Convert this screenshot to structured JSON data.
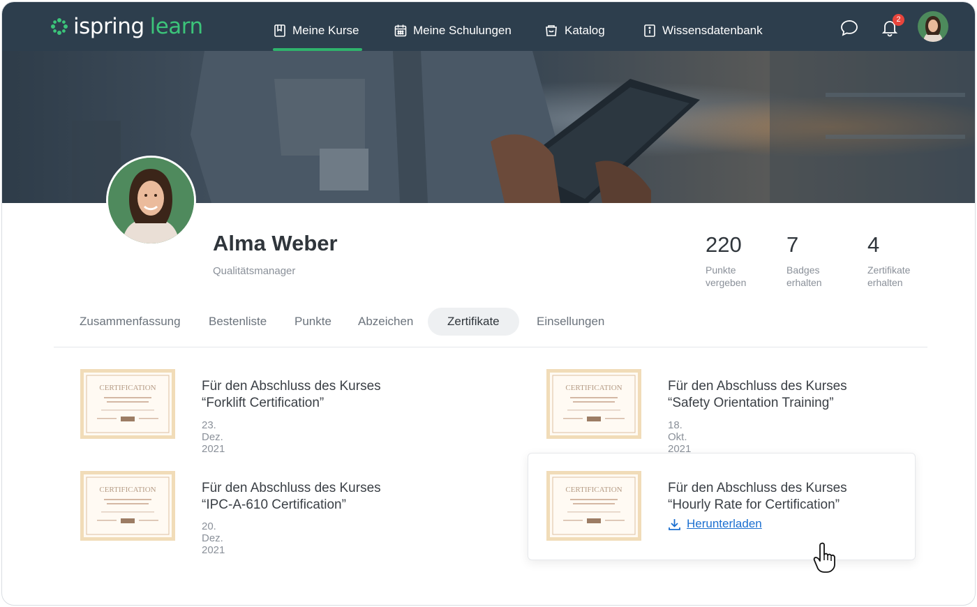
{
  "nav": {
    "logo_text": "ispring",
    "logo_text2": "learn",
    "items": [
      {
        "label": "Meine Kurse",
        "icon": "book-icon",
        "active": true
      },
      {
        "label": "Meine Schulungen",
        "icon": "calendar-icon"
      },
      {
        "label": "Katalog",
        "icon": "basket-icon"
      },
      {
        "label": "Wissensdatenbank",
        "icon": "info-book-icon"
      }
    ],
    "notification_count": "2",
    "accent": "#2fb36c"
  },
  "profile": {
    "name": "Alma Weber",
    "role": "Qualitätsmanager",
    "stats": [
      {
        "value": "220",
        "label1": "Punkte",
        "label2": "vergeben"
      },
      {
        "value": "7",
        "label1": "Badges",
        "label2": "erhalten"
      },
      {
        "value": "4",
        "label1": "Zertifikate",
        "label2": "erhalten"
      }
    ]
  },
  "tabs": [
    {
      "label": "Zusammenfassung"
    },
    {
      "label": "Bestenliste"
    },
    {
      "label": "Punkte"
    },
    {
      "label": "Abzeichen"
    },
    {
      "label": "Zertifikate",
      "active": true
    },
    {
      "label": "Einsellungen"
    }
  ],
  "certificates": [
    {
      "thumb_text": "CERTIFICATION",
      "line1": "Für den Abschluss des Kurses",
      "line2": "“Forklift Certification”",
      "date": "23. Dez. 2021"
    },
    {
      "thumb_text": "CERTIFICATION",
      "line1": "Für den Abschluss des Kurses",
      "line2": "“Safety Orientation Training”",
      "date": "18. Okt. 2021"
    },
    {
      "thumb_text": "CERTIFICATION",
      "line1": "Für den Abschluss des Kurses",
      "line2": "“IPC-A-610 Certification”",
      "date": "20. Dez. 2021"
    },
    {
      "thumb_text": "CERTIFICATION",
      "line1": "Für den Abschluss des Kurses",
      "line2": "“Hourly Rate for Certification”",
      "download_label": "Herunterladen"
    }
  ]
}
